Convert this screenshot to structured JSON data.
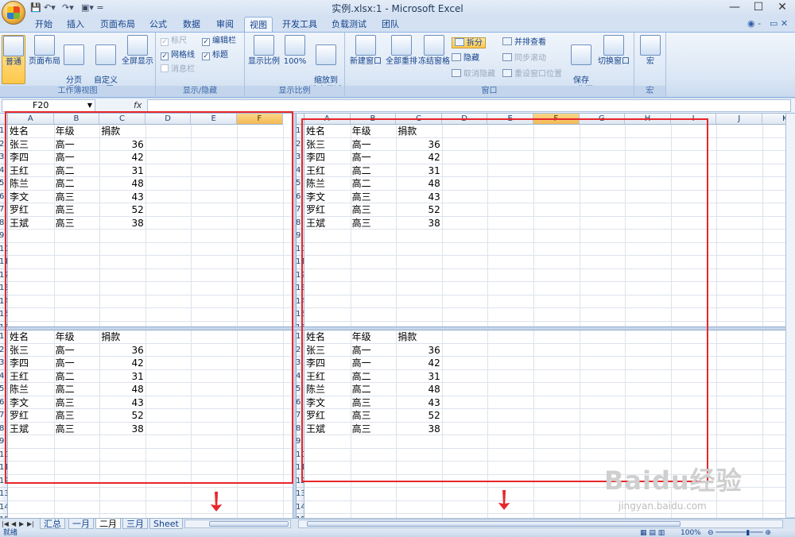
{
  "window": {
    "title": "实例.xlsx:1 - Microsoft Excel"
  },
  "ribbon": {
    "tabs": [
      "开始",
      "插入",
      "页面布局",
      "公式",
      "数据",
      "审阅",
      "视图",
      "开发工具",
      "负载测试",
      "团队"
    ],
    "active_tab": "视图",
    "groups": {
      "workbook_views": {
        "label": "工作簿视图",
        "buttons": [
          "普通",
          "页面布局",
          "分页\n预览",
          "自定义\n视图",
          "全屏显示"
        ]
      },
      "show_hide": {
        "label": "显示/隐藏",
        "checks": [
          {
            "label": "标尺",
            "checked": true,
            "disabled": true
          },
          {
            "label": "编辑栏",
            "checked": true,
            "disabled": false
          },
          {
            "label": "网格线",
            "checked": true,
            "disabled": false
          },
          {
            "label": "标题",
            "checked": true,
            "disabled": false
          },
          {
            "label": "消息栏",
            "checked": false,
            "disabled": true
          }
        ]
      },
      "zoom": {
        "label": "显示比例",
        "buttons": [
          "显示比例",
          "100%",
          "缩放到\n选定区域"
        ]
      },
      "window": {
        "label": "窗口",
        "buttons": [
          "新建窗口",
          "全部重排",
          "冻结窗格",
          "保存\n工作区",
          "切换窗口"
        ],
        "small": [
          "拆分",
          "隐藏",
          "取消隐藏",
          "并排查看",
          "同步滚动",
          "重设窗口位置"
        ]
      },
      "macros": {
        "label": "宏",
        "buttons": [
          "宏"
        ]
      }
    }
  },
  "formula_bar": {
    "name_box": "F20",
    "fx": "fx",
    "value": ""
  },
  "sheet": {
    "columns_left": [
      "A",
      "B",
      "C",
      "D",
      "E",
      "F"
    ],
    "columns_right": [
      "A",
      "B",
      "C",
      "D",
      "E",
      "F",
      "G",
      "H",
      "I",
      "J",
      "K"
    ],
    "rows_top": [
      "1",
      "2",
      "3",
      "4",
      "5",
      "6",
      "7",
      "8",
      "9",
      "10",
      "11",
      "12",
      "13",
      "14",
      "15",
      "16"
    ],
    "rows_bottom": [
      "1",
      "2",
      "3",
      "4",
      "5",
      "6",
      "7",
      "8",
      "9",
      "10",
      "11",
      "12",
      "13",
      "14",
      "15"
    ],
    "header": [
      "姓名",
      "年级",
      "捐款"
    ],
    "data": [
      [
        "张三",
        "高一",
        "36"
      ],
      [
        "李四",
        "高一",
        "42"
      ],
      [
        "王红",
        "高二",
        "31"
      ],
      [
        "陈兰",
        "高二",
        "48"
      ],
      [
        "李文",
        "高三",
        "43"
      ],
      [
        "罗红",
        "高三",
        "52"
      ],
      [
        "王斌",
        "高三",
        "38"
      ]
    ],
    "tabs": [
      "汇总",
      "一月",
      "二月",
      "三月",
      "Sheet"
    ],
    "active_tab": "二月",
    "highlight_column": "F"
  },
  "status": {
    "ready": "就绪",
    "zoom": "100%"
  },
  "watermark": {
    "logo": "Baidu经验",
    "sub": "jingyan.baidu.com"
  },
  "colors": {
    "accent": "#15428b",
    "highlight": "#f2b852",
    "annotation": "#e8262b"
  }
}
